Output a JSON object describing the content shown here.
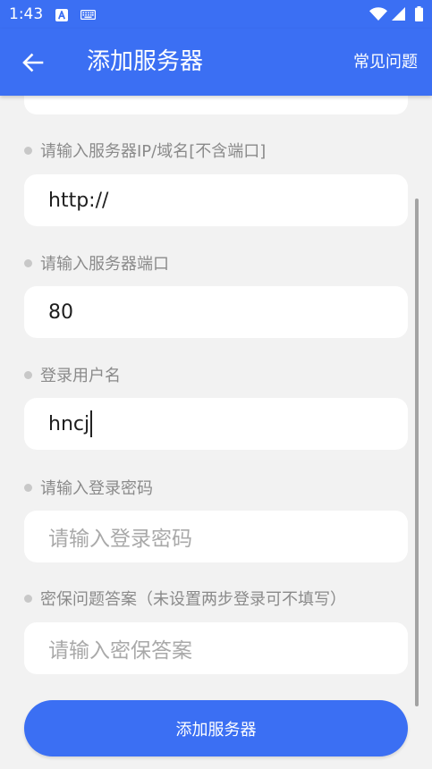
{
  "status_bar": {
    "time": "1:43"
  },
  "app_bar": {
    "title": "添加服务器",
    "faq_label": "常见问题"
  },
  "form": {
    "fields": [
      {
        "label": "请输入服务器IP/域名[不含端口]",
        "value": "http://"
      },
      {
        "label": "请输入服务器端口",
        "value": "80"
      },
      {
        "label": "登录用户名",
        "value": "hncj"
      },
      {
        "label": "请输入登录密码",
        "placeholder": "请输入登录密码"
      },
      {
        "label": "密保问题答案（未设置两步登录可不填写）",
        "placeholder": "请输入密保答案"
      }
    ],
    "submit_label": "添加服务器"
  },
  "icons": {
    "back": "back-arrow-icon",
    "notification": "app-letter-a-icon",
    "keyboard": "keyboard-icon",
    "wifi": "wifi-icon",
    "signal": "cell-signal-icon",
    "battery": "battery-icon"
  },
  "colors": {
    "primary": "#3b6ff3",
    "background": "#f2f2f2",
    "label": "#8a8a8a",
    "dot": "#c8c8c8",
    "text": "#1e1e1e",
    "placeholder": "#a9a9a9"
  }
}
